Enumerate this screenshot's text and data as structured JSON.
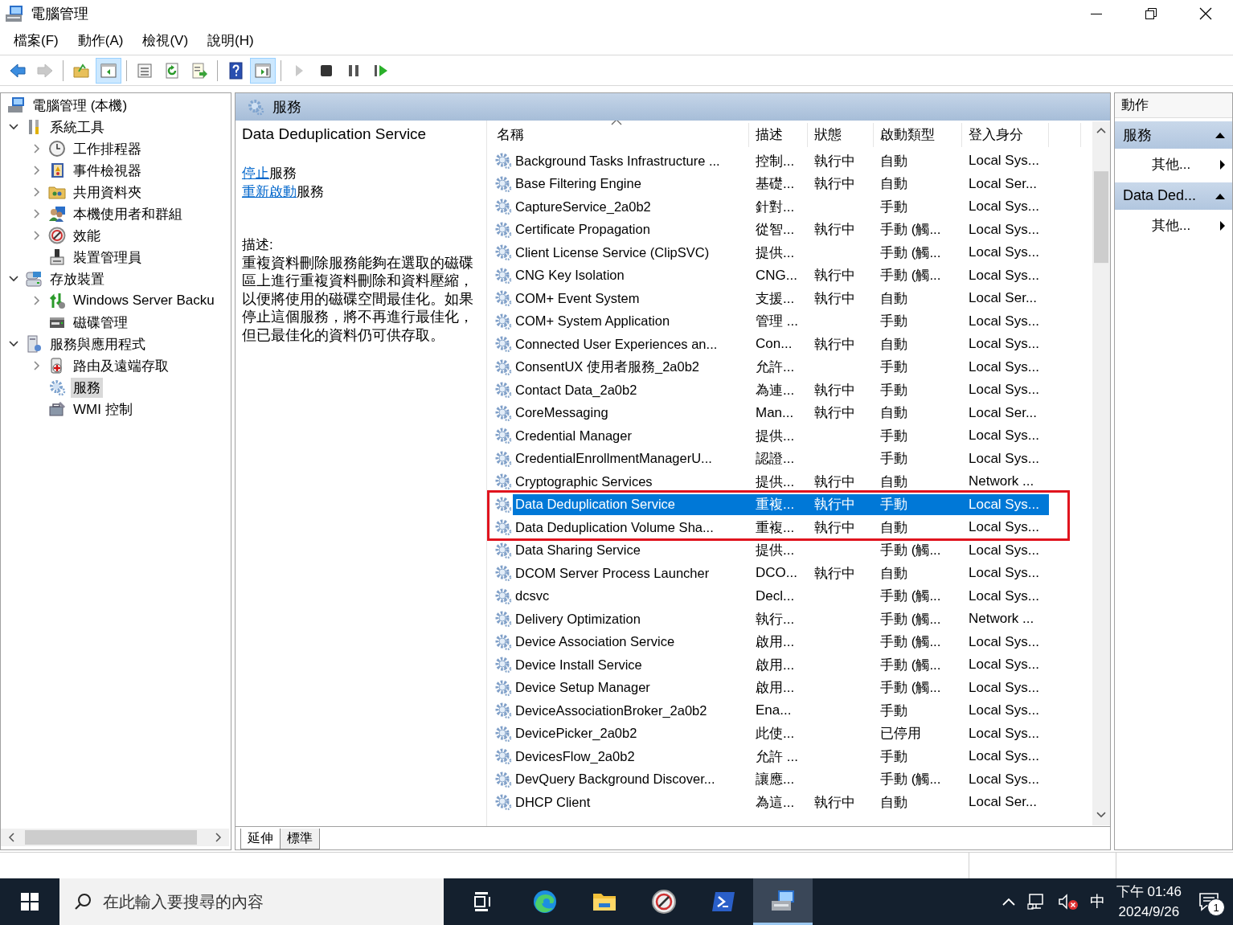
{
  "window": {
    "title": "電腦管理"
  },
  "menu": [
    "檔案(F)",
    "動作(A)",
    "檢視(V)",
    "說明(H)"
  ],
  "toolbar": [
    {
      "selected": false,
      "disabled": false
    },
    {
      "selected": false,
      "disabled": true
    },
    {
      "selected": false,
      "disabled": false
    },
    {
      "selected": true,
      "disabled": false
    },
    {
      "selected": false,
      "disabled": false
    },
    {
      "selected": false,
      "disabled": false
    },
    {
      "selected": false,
      "disabled": false
    },
    {
      "selected": false,
      "disabled": false
    },
    {
      "selected": true,
      "disabled": false
    },
    {
      "selected": false,
      "disabled": true
    },
    {
      "selected": false,
      "disabled": false
    },
    {
      "selected": false,
      "disabled": false
    },
    {
      "selected": false,
      "disabled": false
    }
  ],
  "tree": [
    {
      "label": "電腦管理 (本機)",
      "selected": false,
      "children": [
        {
          "label": "系統工具",
          "selected": false,
          "expanded": true,
          "children": [
            {
              "label": "工作排程器",
              "selected": false,
              "expanded": false
            },
            {
              "label": "事件檢視器",
              "selected": false,
              "expanded": false
            },
            {
              "label": "共用資料夾",
              "selected": false,
              "expanded": false
            },
            {
              "label": "本機使用者和群組",
              "selected": false,
              "expanded": false
            },
            {
              "label": "效能",
              "selected": false,
              "expanded": false
            },
            {
              "label": "裝置管理員",
              "selected": false
            }
          ]
        },
        {
          "label": "存放裝置",
          "selected": false,
          "expanded": true,
          "children": [
            {
              "label": "Windows Server Backu",
              "selected": false,
              "expanded": false
            },
            {
              "label": "磁碟管理",
              "selected": false
            }
          ]
        },
        {
          "label": "服務與應用程式",
          "selected": false,
          "expanded": true,
          "children": [
            {
              "label": "路由及遠端存取",
              "selected": false,
              "expanded": false
            },
            {
              "label": "服務",
              "selected": true
            },
            {
              "label": "WMI 控制",
              "selected": false
            }
          ]
        }
      ]
    }
  ],
  "panel": {
    "title": "服務",
    "details": {
      "service_name": "Data Deduplication Service",
      "links": [
        {
          "link": "停止",
          "text": "服務"
        },
        {
          "link": "重新啟動",
          "text": "服務"
        }
      ],
      "description_label": "描述:",
      "description": "重複資料刪除服務能夠在選取的磁碟區上進行重複資料刪除和資料壓縮，以便將使用的磁碟空間最佳化。如果停止這個服務，將不再進行最佳化，但已最佳化的資料仍可供存取。"
    },
    "table": {
      "columns": [
        {
          "label": "名稱",
          "sorted": true
        },
        {
          "label": "描述",
          "sorted": false
        },
        {
          "label": "狀態",
          "sorted": false
        },
        {
          "label": "啟動類型",
          "sorted": false
        },
        {
          "label": "登入身分",
          "sorted": false
        }
      ],
      "rows": [
        {
          "name": "Background Tasks Infrastructure ...",
          "description": "控制...",
          "status": "執行中",
          "startup": "自動",
          "logon": "Local Sys...",
          "selected": false,
          "highlighted": false
        },
        {
          "name": "Base Filtering Engine",
          "description": "基礎...",
          "status": "執行中",
          "startup": "自動",
          "logon": "Local Ser...",
          "selected": false,
          "highlighted": false
        },
        {
          "name": "CaptureService_2a0b2",
          "description": "針對...",
          "startup": "手動",
          "logon": "Local Sys...",
          "selected": false,
          "highlighted": false
        },
        {
          "name": "Certificate Propagation",
          "description": "從智...",
          "status": "執行中",
          "startup": "手動 (觸...",
          "logon": "Local Sys...",
          "selected": false,
          "highlighted": false
        },
        {
          "name": "Client License Service (ClipSVC)",
          "description": "提供...",
          "startup": "手動 (觸...",
          "logon": "Local Sys...",
          "selected": false,
          "highlighted": false
        },
        {
          "name": "CNG Key Isolation",
          "description": "CNG...",
          "status": "執行中",
          "startup": "手動 (觸...",
          "logon": "Local Sys...",
          "selected": false,
          "highlighted": false
        },
        {
          "name": "COM+ Event System",
          "description": "支援...",
          "status": "執行中",
          "startup": "自動",
          "logon": "Local Ser...",
          "selected": false,
          "highlighted": false
        },
        {
          "name": "COM+ System Application",
          "description": "管理 ...",
          "startup": "手動",
          "logon": "Local Sys...",
          "selected": false,
          "highlighted": false
        },
        {
          "name": "Connected User Experiences an...",
          "description": "Con...",
          "status": "執行中",
          "startup": "自動",
          "logon": "Local Sys...",
          "selected": false,
          "highlighted": false
        },
        {
          "name": "ConsentUX 使用者服務_2a0b2",
          "description": "允許...",
          "startup": "手動",
          "logon": "Local Sys...",
          "selected": false,
          "highlighted": false
        },
        {
          "name": "Contact Data_2a0b2",
          "description": "為連...",
          "status": "執行中",
          "startup": "手動",
          "logon": "Local Sys...",
          "selected": false,
          "highlighted": false
        },
        {
          "name": "CoreMessaging",
          "description": "Man...",
          "status": "執行中",
          "startup": "自動",
          "logon": "Local Ser...",
          "selected": false,
          "highlighted": false
        },
        {
          "name": "Credential Manager",
          "description": "提供...",
          "startup": "手動",
          "logon": "Local Sys...",
          "selected": false,
          "highlighted": false
        },
        {
          "name": "CredentialEnrollmentManagerU...",
          "description": "認證...",
          "startup": "手動",
          "logon": "Local Sys...",
          "selected": false,
          "highlighted": false
        },
        {
          "name": "Cryptographic Services",
          "description": "提供...",
          "status": "執行中",
          "startup": "自動",
          "logon": "Network ...",
          "selected": false,
          "highlighted": false
        },
        {
          "name": "Data Deduplication Service",
          "description": "重複...",
          "status": "執行中",
          "startup": "手動",
          "logon": "Local Sys...",
          "selected": true,
          "highlighted": true
        },
        {
          "name": "Data Deduplication Volume Sha...",
          "description": "重複...",
          "status": "執行中",
          "startup": "自動",
          "logon": "Local Sys...",
          "selected": false,
          "highlighted": true
        },
        {
          "name": "Data Sharing Service",
          "description": "提供...",
          "startup": "手動 (觸...",
          "logon": "Local Sys...",
          "selected": false,
          "highlighted": false
        },
        {
          "name": "DCOM Server Process Launcher",
          "description": "DCO...",
          "status": "執行中",
          "startup": "自動",
          "logon": "Local Sys...",
          "selected": false,
          "highlighted": false
        },
        {
          "name": "dcsvc",
          "description": "Decl...",
          "startup": "手動 (觸...",
          "logon": "Local Sys...",
          "selected": false,
          "highlighted": false
        },
        {
          "name": "Delivery Optimization",
          "description": "執行...",
          "startup": "手動 (觸...",
          "logon": "Network ...",
          "selected": false,
          "highlighted": false
        },
        {
          "name": "Device Association Service",
          "description": "啟用...",
          "startup": "手動 (觸...",
          "logon": "Local Sys...",
          "selected": false,
          "highlighted": false
        },
        {
          "name": "Device Install Service",
          "description": "啟用...",
          "startup": "手動 (觸...",
          "logon": "Local Sys...",
          "selected": false,
          "highlighted": false
        },
        {
          "name": "Device Setup Manager",
          "description": "啟用...",
          "startup": "手動 (觸...",
          "logon": "Local Sys...",
          "selected": false,
          "highlighted": false
        },
        {
          "name": "DeviceAssociationBroker_2a0b2",
          "description": "Ena...",
          "startup": "手動",
          "logon": "Local Sys...",
          "selected": false,
          "highlighted": false
        },
        {
          "name": "DevicePicker_2a0b2",
          "description": "此使...",
          "startup": "已停用",
          "logon": "Local Sys...",
          "selected": false,
          "highlighted": false
        },
        {
          "name": "DevicesFlow_2a0b2",
          "description": "允許 ...",
          "startup": "手動",
          "logon": "Local Sys...",
          "selected": false,
          "highlighted": false
        },
        {
          "name": "DevQuery Background Discover...",
          "description": "讓應...",
          "startup": "手動 (觸...",
          "logon": "Local Sys...",
          "selected": false,
          "highlighted": false
        },
        {
          "name": "DHCP Client",
          "description": "為這...",
          "status": "執行中",
          "startup": "自動",
          "logon": "Local Ser...",
          "selected": false,
          "highlighted": false
        }
      ]
    },
    "tabs": [
      {
        "label": "延伸",
        "selected": true
      },
      {
        "label": "標準",
        "selected": false
      }
    ]
  },
  "actions": {
    "title": "動作",
    "sections": [
      {
        "title": "服務",
        "expanded": true,
        "items": [
          "其他..."
        ]
      },
      {
        "title": "Data Ded...",
        "expanded": true,
        "items": [
          "其他..."
        ]
      }
    ]
  },
  "taskbar": {
    "search": {
      "placeholder": "在此輸入要搜尋的內容"
    },
    "apps": [
      {
        "active": false
      },
      {
        "active": false
      },
      {
        "active": false
      },
      {
        "active": false
      },
      {
        "active": false
      },
      {
        "active": true
      }
    ],
    "tray": {
      "ime": "中",
      "time": "下午 01:46",
      "date": "2024/9/26",
      "notifications": "1"
    }
  }
}
